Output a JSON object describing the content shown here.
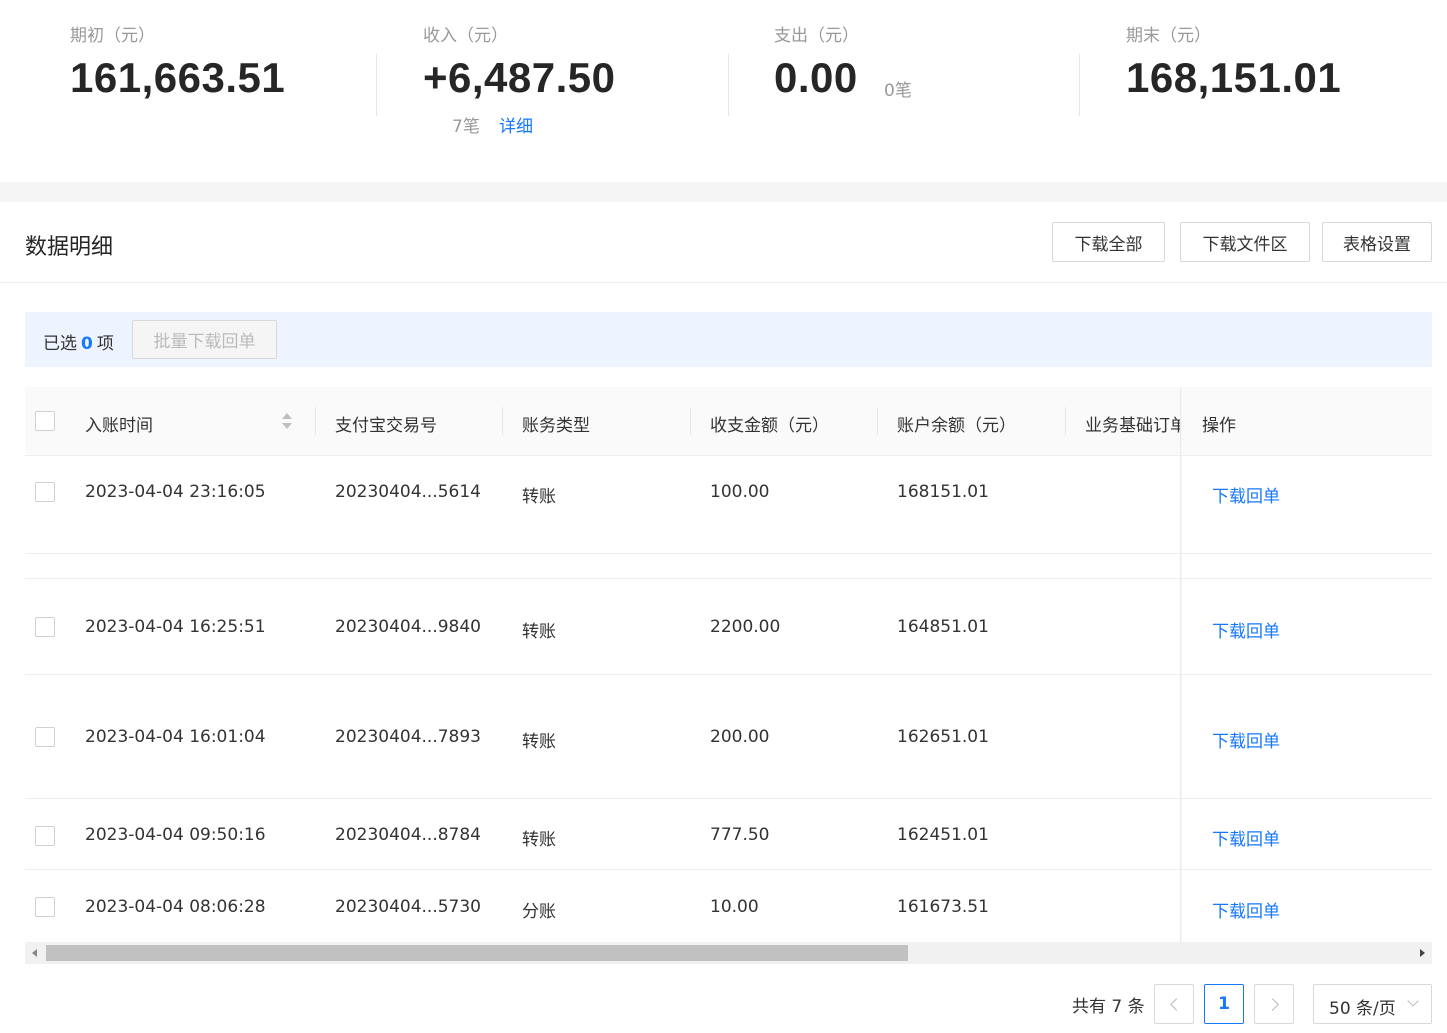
{
  "summary": {
    "opening": {
      "label": "期初（元）",
      "value": "161,663.51"
    },
    "income": {
      "label": "收入（元）",
      "value": "+6,487.50",
      "count": "7笔",
      "detail_link": "详细"
    },
    "expense": {
      "label": "支出（元）",
      "value": "0.00",
      "count": "0笔"
    },
    "closing": {
      "label": "期末（元）",
      "value": "168,151.01"
    }
  },
  "section": {
    "title": "数据明细",
    "download_all": "下载全部",
    "download_files": "下载文件区",
    "table_settings": "表格设置"
  },
  "selection": {
    "prefix": "已选",
    "count": "0",
    "suffix": "项",
    "batch_download": "批量下载回单"
  },
  "table": {
    "columns": [
      "入账时间",
      "支付宝交易号",
      "账务类型",
      "收支金额（元）",
      "账户余额（元）",
      "业务基础订单",
      "操作"
    ],
    "rows": [
      {
        "time": "2023-04-04 23:16:05",
        "trade_no": "20230404...5614",
        "type": "转账",
        "amount": "100.00",
        "balance": "168151.01",
        "action": "下载回单"
      },
      {
        "time": "2023-04-04 16:25:51",
        "trade_no": "20230404...9840",
        "type": "转账",
        "amount": "2200.00",
        "balance": "164851.01",
        "action": "下载回单"
      },
      {
        "time": "2023-04-04 16:01:04",
        "trade_no": "20230404...7893",
        "type": "转账",
        "amount": "200.00",
        "balance": "162651.01",
        "action": "下载回单"
      },
      {
        "time": "2023-04-04 09:50:16",
        "trade_no": "20230404...8784",
        "type": "转账",
        "amount": "777.50",
        "balance": "162451.01",
        "action": "下载回单"
      },
      {
        "time": "2023-04-04 08:06:28",
        "trade_no": "20230404...5730",
        "type": "分账",
        "amount": "10.00",
        "balance": "161673.51",
        "action": "下载回单"
      }
    ]
  },
  "pagination": {
    "total": "共有 7 条",
    "current_page": "1",
    "page_size": "50 条/页"
  },
  "colors": {
    "accent": "#1677ff",
    "selection_bg": "#edf3ff"
  }
}
